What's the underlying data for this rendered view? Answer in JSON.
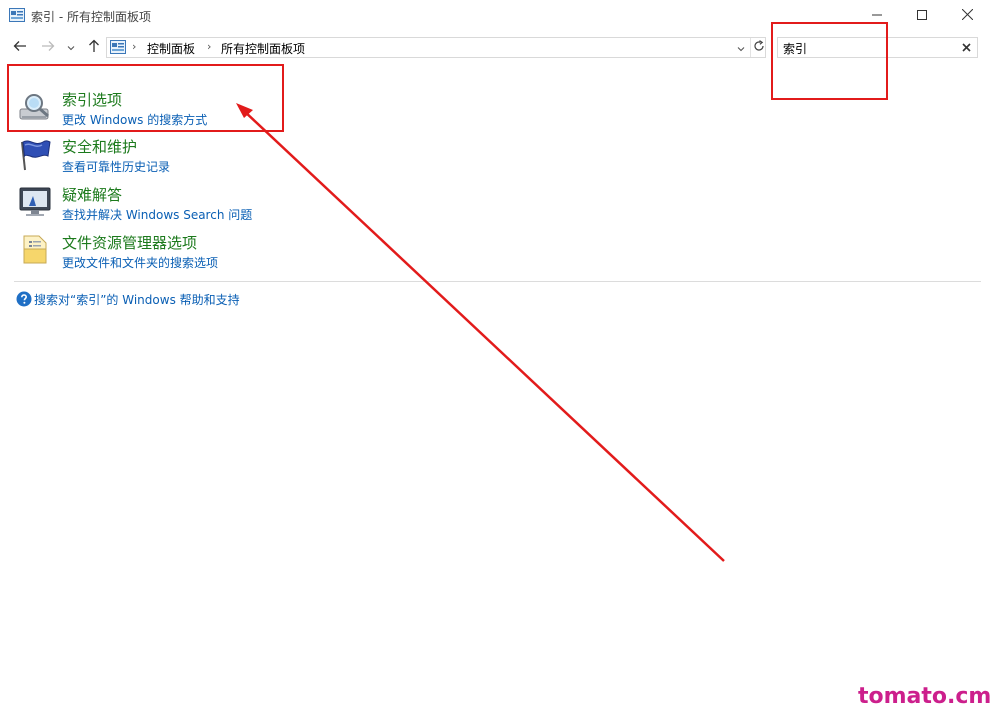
{
  "window": {
    "title": "索引 - 所有控制面板项",
    "minimize_icon": "minimize-icon",
    "maximize_icon": "maximize-icon",
    "close_icon": "close-icon"
  },
  "navigation": {
    "back_icon": "arrow-left-icon",
    "forward_icon": "arrow-right-icon",
    "recent_icon": "chevron-down-icon",
    "up_icon": "arrow-up-icon",
    "address": {
      "crumbs": [
        "控制面板",
        "所有控制面板项"
      ],
      "dropdown_icon": "chevron-down-icon",
      "refresh_icon": "refresh-icon"
    },
    "search": {
      "value": "索引",
      "clear_icon": "clear-icon"
    }
  },
  "results": [
    {
      "title": "索引选项",
      "link": "更改 Windows 的搜索方式",
      "icon": "indexing-options-icon"
    },
    {
      "title": "安全和维护",
      "link": "查看可靠性历史记录",
      "icon": "flag-icon"
    },
    {
      "title": "疑难解答",
      "link": "查找并解决 Windows Search 问题",
      "icon": "troubleshooting-icon"
    },
    {
      "title": "文件资源管理器选项",
      "link": "更改文件和文件夹的搜索选项",
      "icon": "folder-options-icon"
    }
  ],
  "help": {
    "text": "搜索对“索引”的 Windows 帮助和支持",
    "icon": "help-icon"
  },
  "annotations": {
    "color": "#e21b1b"
  },
  "colors": {
    "title_green": "#1c7a1c",
    "link_blue": "#0a5fb4",
    "watermark": "#cc1f8c"
  },
  "watermark": "tomato.cm"
}
